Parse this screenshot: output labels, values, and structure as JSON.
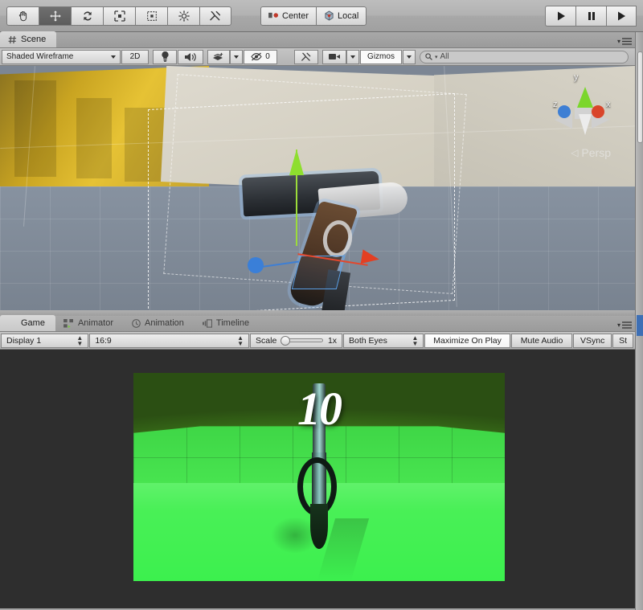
{
  "toolbar": {
    "tools": [
      {
        "name": "hand-tool",
        "icon": "hand-icon",
        "active": false
      },
      {
        "name": "move-tool",
        "icon": "move-icon",
        "active": true
      },
      {
        "name": "rotate-tool",
        "icon": "rotate-icon",
        "active": false
      },
      {
        "name": "scale-tool",
        "icon": "scale-icon",
        "active": false
      },
      {
        "name": "rect-tool",
        "icon": "rect-transform-icon",
        "active": false
      },
      {
        "name": "transform-tool",
        "icon": "transform-icon",
        "active": false
      },
      {
        "name": "custom-tool",
        "icon": "wrench-screwdriver-icon",
        "active": false
      }
    ],
    "pivot_mode": "Center",
    "pivot_rotation": "Local",
    "play": "▶",
    "pause": "❙❙",
    "step": "▶"
  },
  "scene_panel": {
    "tabs": [
      {
        "label": "Scene",
        "icon": "grid-hash-icon",
        "active": true
      }
    ],
    "toolbar": {
      "draw_mode": "Shaded Wireframe",
      "mode_2d": "2D",
      "lighting_icon": "lightbulb-icon",
      "audio_icon": "speaker-icon",
      "effects_icon": "effects-icon",
      "hidden_count": "0",
      "hidden_icon": "eye-slash-icon",
      "tools_icon": "wrench-screwdriver-icon",
      "camera_icon": "camera-icon",
      "gizmos": "Gizmos",
      "search_placeholder": "All",
      "search_value": "All",
      "search_icon": "search-icon"
    },
    "orientation_gizmo": {
      "x_label": "x",
      "y_label": "y",
      "z_label": "z",
      "x_color": "#d9452a",
      "y_color": "#7bd62c",
      "z_color": "#3e7fd4",
      "projection": "Persp"
    },
    "selection": {
      "object": "pistol",
      "gizmo": "move-gizmo",
      "axis_colors": {
        "x": "#e3472c",
        "y": "#8ede2e",
        "z": "#3a7fd8"
      }
    },
    "scene_camera_gizmo": "camera-gizmo-icon"
  },
  "game_panel": {
    "tabs": [
      {
        "label": "Game",
        "icon": "game-icon",
        "active": true
      },
      {
        "label": "Animator",
        "icon": "animator-icon",
        "active": false
      },
      {
        "label": "Animation",
        "icon": "clock-icon",
        "active": false
      },
      {
        "label": "Timeline",
        "icon": "timeline-icon",
        "active": false
      }
    ],
    "toolbar": {
      "display": "Display 1",
      "aspect": "16:9",
      "scale_label": "Scale",
      "scale_value": "1x",
      "stereo": "Both Eyes",
      "maximize_on_play": "Maximize On Play",
      "mute_audio": "Mute Audio",
      "vsync": "VSync",
      "stats": "St"
    },
    "render": {
      "hud_counter": "10",
      "description": "first-person view of a pistol in a green room"
    }
  },
  "panel_menu_icon": "panel-options-icon",
  "colors": {
    "chrome": "#b2b2b2",
    "scene_bg": "#7c8694",
    "game_bg": "#2e2e2e",
    "accent_blue": "#3d6fb5"
  }
}
